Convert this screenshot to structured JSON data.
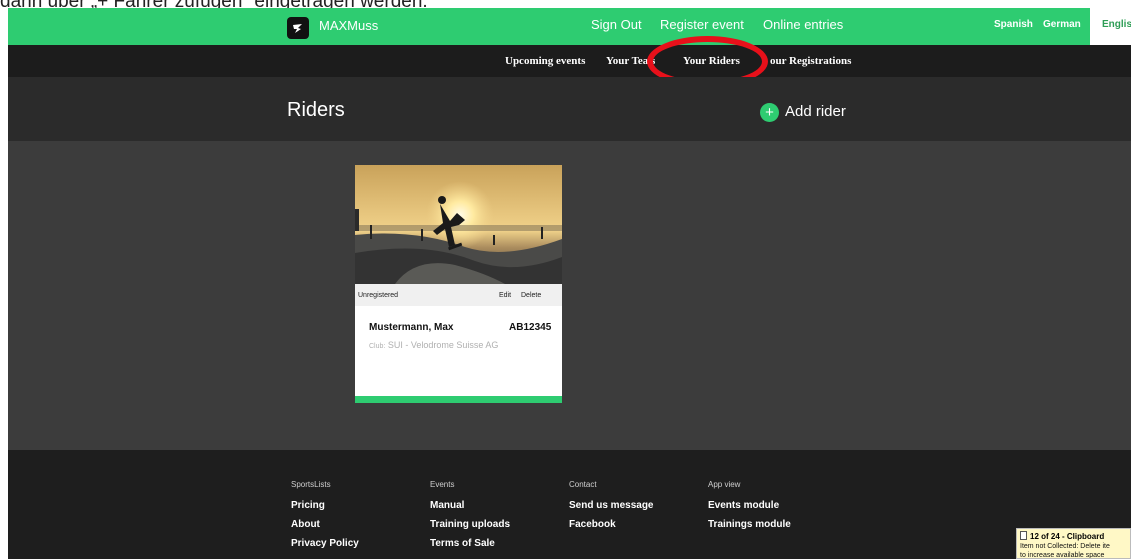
{
  "caption": {
    "text": "dann über „+ Fahrer zufügen\" eingetragen werden."
  },
  "topbar": {
    "brand": "MAXMuss",
    "links": {
      "sign_out": "Sign Out",
      "register_event": "Register event",
      "online_entries": "Online entries"
    },
    "languages": {
      "spanish": "Spanish",
      "german": "German",
      "english": "English"
    },
    "colors": {
      "accent": "#2ecc71"
    }
  },
  "subnav": {
    "upcoming_events": "Upcoming events",
    "your_teams": "Your Tea  s",
    "your_riders": "Your Riders",
    "your_registrations": "our Registrations"
  },
  "page": {
    "title": "Riders",
    "add_rider": "Add rider",
    "add_icon": "+"
  },
  "rider_card": {
    "status": "Unregistered",
    "edit": "Edit",
    "delete": "Delete",
    "name": "Mustermann, Max",
    "id": "AB12345",
    "club_prefix": "Club:",
    "club": "SUI - Velodrome Suisse AG",
    "photo": "skateboarder-sunset-image"
  },
  "footer": {
    "col1": {
      "heading": "SportsLists",
      "links": [
        "Pricing",
        "About",
        "Privacy Policy"
      ]
    },
    "col2": {
      "heading": "Events",
      "links": [
        "Manual",
        "Training uploads",
        "Terms of Sale"
      ]
    },
    "col3": {
      "heading": "Contact",
      "links": [
        "Send us message",
        "Facebook"
      ]
    },
    "col4": {
      "heading": "App view",
      "links": [
        "Events module",
        "Trainings module"
      ]
    }
  },
  "clipboard": {
    "title": "12 of 24 - Clipboard",
    "line1": "Item not Collected: Delete ite",
    "line2": "to increase available space"
  },
  "annotation": {
    "color": "#e8101a"
  }
}
